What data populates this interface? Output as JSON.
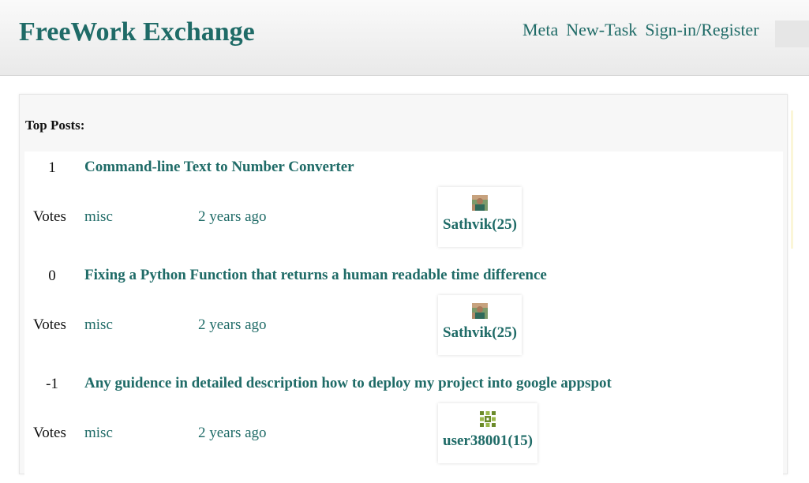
{
  "header": {
    "brand": "FreeWork Exchange",
    "nav": [
      "Meta",
      "New-Task",
      "Sign-in/Register"
    ]
  },
  "main": {
    "section_title": "Top Posts:",
    "posts": [
      {
        "votes": "1",
        "votes_label": "Votes",
        "title": "Command-line Text to Number Converter",
        "tag": "misc",
        "time": "2 years ago",
        "user": "Sathvik(25)",
        "avatar_icon": "user-photo-icon"
      },
      {
        "votes": "0",
        "votes_label": "Votes",
        "title": "Fixing a Python Function that returns a human readable time difference",
        "tag": "misc",
        "time": "2 years ago",
        "user": "Sathvik(25)",
        "avatar_icon": "user-photo-icon"
      },
      {
        "votes": "-1",
        "votes_label": "Votes",
        "title": "Any guidence in detailed description how to deploy my project into google appspot",
        "tag": "misc",
        "time": "2 years ago",
        "user": "user38001(15)",
        "avatar_icon": "identicon-icon"
      }
    ]
  },
  "colors": {
    "accent": "#1f6b67",
    "header_bg": "#ececec",
    "panel_bg": "#f7f7f7"
  }
}
